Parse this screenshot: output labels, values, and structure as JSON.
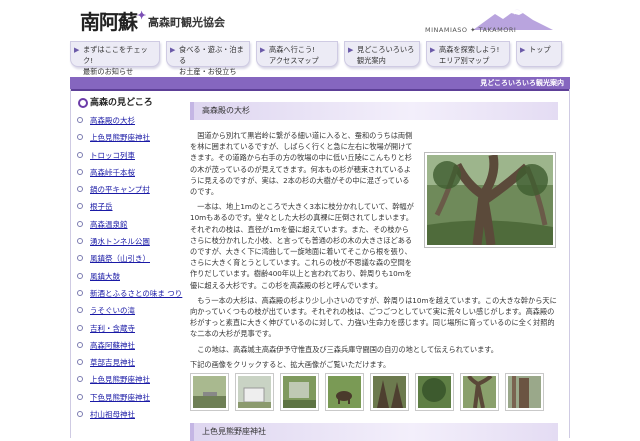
{
  "header": {
    "logo_text": "南阿蘇",
    "association": "高森町観光協会",
    "brand": "MINAMIASO ✦ TAKAMORI"
  },
  "nav": [
    {
      "line1": "まずはここをチェック!",
      "line2": "最新のお知らせ"
    },
    {
      "line1": "食べる・遊ぶ・泊まる",
      "line2": "お土産・お役立ち"
    },
    {
      "line1": "高森へ行こう!",
      "line2": "アクセスマップ"
    },
    {
      "line1": "見どころいろいろ",
      "line2": "観光案内"
    },
    {
      "line1": "高森を探索しよう!",
      "line2": "エリア別マップ"
    },
    {
      "line1": "トップ",
      "line2": ""
    }
  ],
  "band_label": "見どころいろいろ観光案内",
  "sidebar": {
    "title": "高森の見どころ",
    "items": [
      "高森殿の大杉",
      "上色見熊野座神社",
      "トロッコ列車",
      "高森峠千本桜",
      "鍋の平キャンプ村",
      "根子岳",
      "高森温泉館",
      "湧水トンネル公園",
      "風鎮祭（山引き）",
      "風鎮大鼓",
      "新酒とふるさとの味ま つり",
      "うそぐいの滝",
      "吉利・含蔵寺",
      "高森阿蘇神社",
      "草部吉見神社",
      "上色見熊野座神社",
      "下色見熊野座神社",
      "村山祖母神社"
    ]
  },
  "main": {
    "section_title": "高森殿の大杉",
    "paragraphs": [
      "国道から別れて黒岩岭に繋がる細い道に入ると、蚕和のうちは両側を林に囲まれているですが、しばらく行くと急に左右に牧場が開けてきます。その道路から右手の方の牧場の中に低い丘陵にこんもりと杉の木が茂っているのが見えてきます。何本もの杉が穂束されているように見えるのですが、実は、2本の杉の大樹がその中に混ざっているのです。",
      "一本は、地上1mのところで大きく3本に枝分かれしていて、幹幅が10mもあるのです。堂々とした大杉の真裸に圧倒されてしまいます。それぞれの枝は、直径が1mを優に超えています。また、その枝からさらに枝分かれした小枝、と言っても普通の杉の木の大きさほどあるのですが、大きく下に湾曲して一旋地面に着いてそこから根を張り、さらに大きく育とうとしています。これらの枝が不思議な森の空間を作りだしています。樹齢400年以上と言われており、幹周りも10mを優に超える大杉です。この杉を高森殿の杉と呼んでいます。",
      "もう一本の大杉は、高森殿の杉より少し小さいのですが、幹周りは10mを越えています。この大きな幹から天に向かっていくつもの枝が出ています。それぞれの枝は、ごつごつとしていて実に荒々しい感じがします。高森殿の杉がすっと素直に大きく伸びているのに対して、力強い生命力を感じます。同じ場所に育っているのに全く対照的な二本の大杉が見事です。",
      "この地は、高森城主高森伊予守惟直及び三森兵庫守闘国の自刃の地として伝えられています。",
      "下記の画像をクリックすると、拡大画像がご覧いただけます。"
    ],
    "next_section_title": "上色見熊野座神社"
  },
  "colors": {
    "band": "#8566bf",
    "link": "#1a1aa6",
    "accent": "#6b3ba8"
  }
}
